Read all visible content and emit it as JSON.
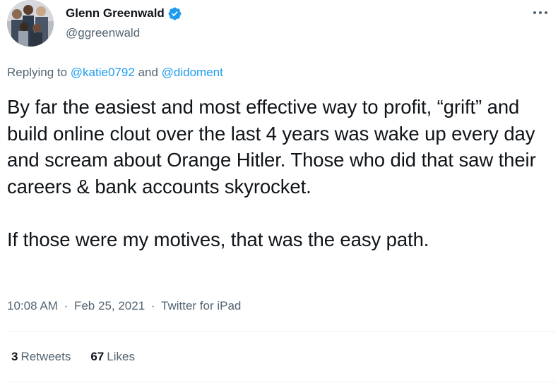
{
  "tweet": {
    "author": {
      "display_name": "Glenn Greenwald",
      "handle": "@ggreenwald",
      "verified": true,
      "avatar_icon": "profile-photo"
    },
    "more_icon": "ellipsis-icon",
    "replying": {
      "prefix": "Replying to",
      "mention_1": "@katie0792",
      "conjunction": "and",
      "mention_2": "@didoment"
    },
    "text": {
      "paragraph_1": "By far the easiest and most effective way to profit, “grift” and build online clout over the last 4 years was wake up every day and scream about Orange Hitler. Those who did that saw their careers & bank accounts skyrocket.",
      "paragraph_2": "If those were my motives, that was the easy path."
    },
    "meta": {
      "time": "10:08 AM",
      "separator": "·",
      "date": "Feb 25, 2021",
      "source": "Twitter for iPad"
    },
    "stats": {
      "retweets_count": "3",
      "retweets_label": "Retweets",
      "likes_count": "67",
      "likes_label": "Likes"
    }
  },
  "colors": {
    "text": "#0f1419",
    "secondary": "#536471",
    "accent": "#1d9bf0",
    "divider": "#eff3f4"
  }
}
